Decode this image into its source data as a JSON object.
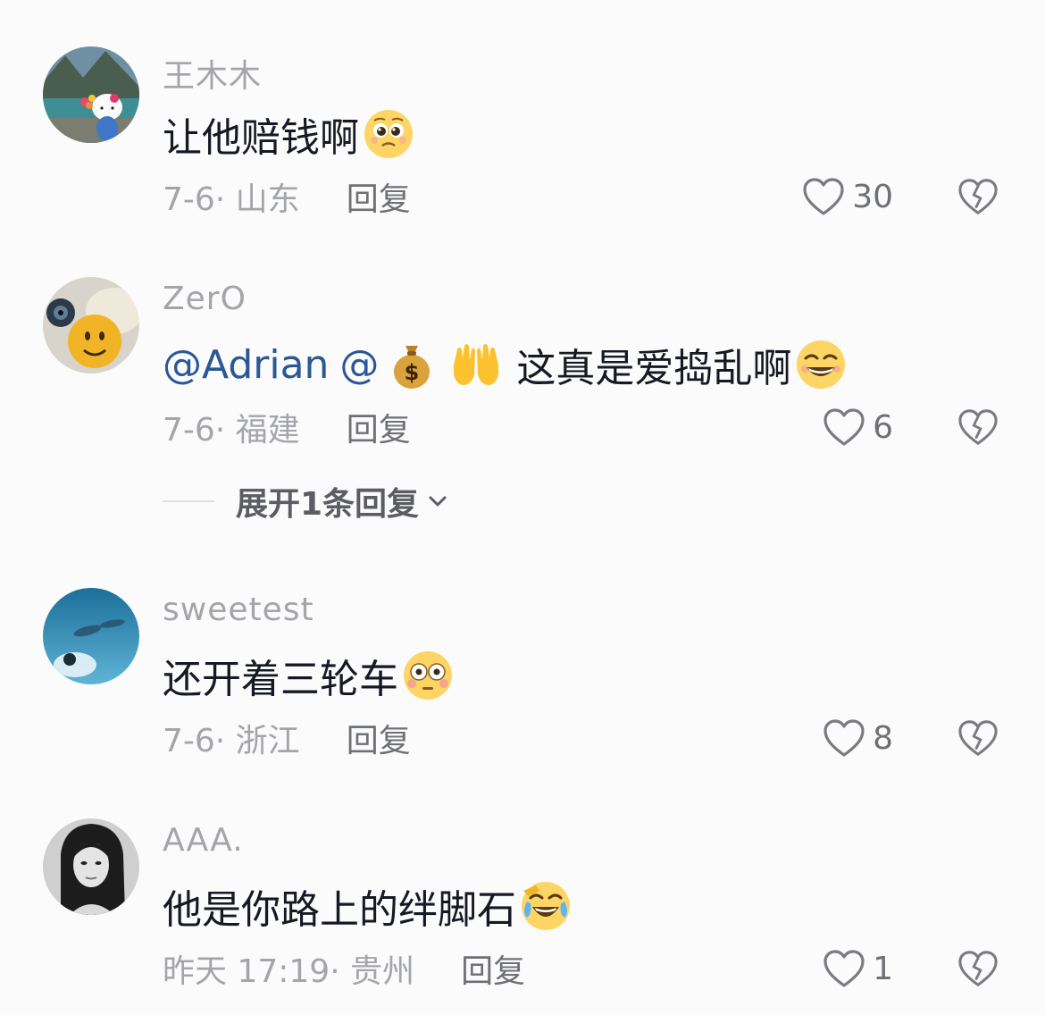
{
  "comments": [
    {
      "username": "王木木",
      "text": "让他赔钱啊",
      "date_location": "7-6· 山东",
      "reply_label": "回复",
      "likes": "30"
    },
    {
      "username": "ZerO",
      "mention1": "@Adrian",
      "mention2": "@",
      "text": "这真是爱捣乱啊",
      "date_location": "7-6· 福建",
      "reply_label": "回复",
      "likes": "6",
      "expand_label": "展开1条回复"
    },
    {
      "username": "sweetest",
      "text": "还开着三轮车",
      "date_location": "7-6· 浙江",
      "reply_label": "回复",
      "likes": "8"
    },
    {
      "username": "AAA.",
      "text": "他是你路上的绊脚石",
      "date_location": "昨天 17:19· 贵州",
      "reply_label": "回复",
      "likes": "1"
    }
  ],
  "colors": {
    "background": "#fbfbfb",
    "text": "#161823",
    "secondary": "#a4a5a9",
    "mention": "#2a5896"
  },
  "icons": [
    "heart-icon",
    "heart-broken-icon",
    "chevron-down-icon"
  ]
}
